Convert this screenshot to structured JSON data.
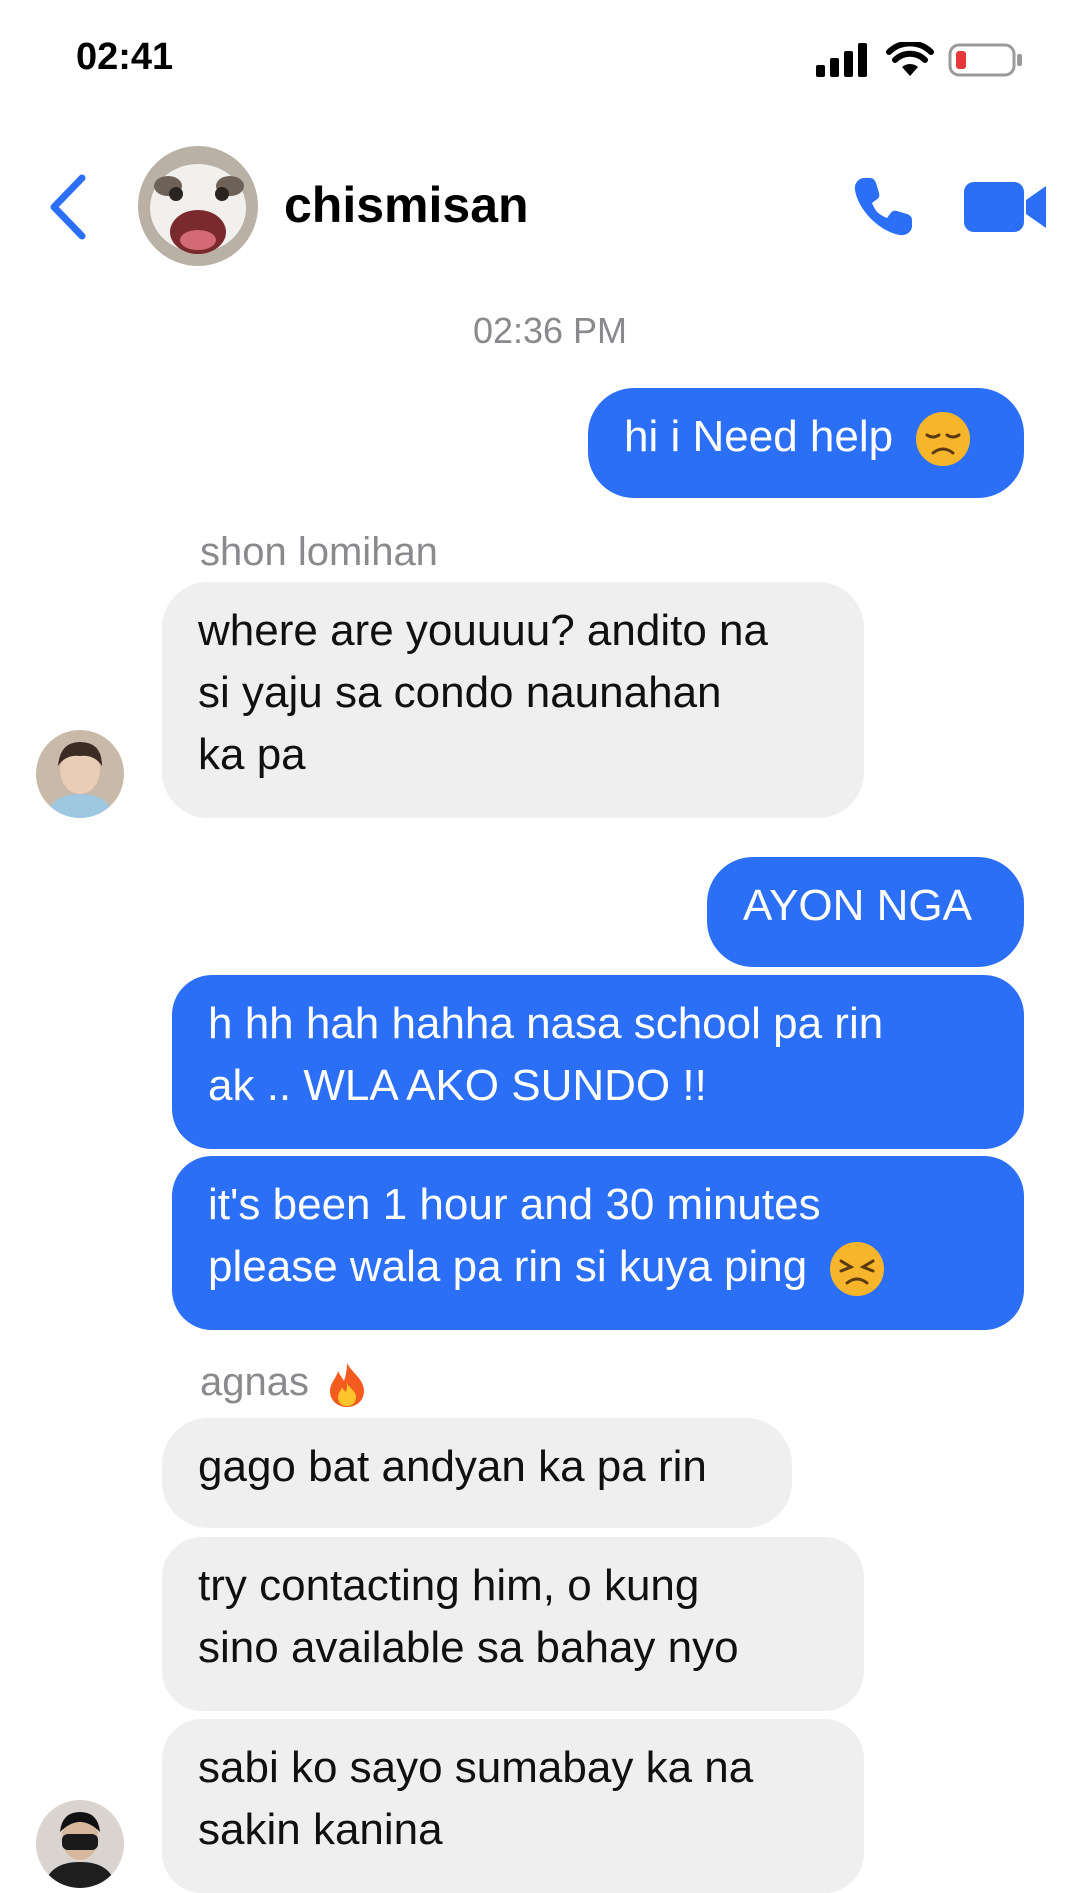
{
  "status_bar": {
    "time": "02:41"
  },
  "header": {
    "title": "chismisan"
  },
  "chat": {
    "timestamp": "02:36 PM",
    "messages": [
      {
        "text": "hi i Need help",
        "emoji": "disappointed-face"
      },
      {
        "sender": "shon lomihan"
      },
      {
        "line1": "where are youuuu? andito na",
        "line2": "si yaju sa condo naunahan",
        "line3": "ka pa"
      },
      {
        "text": "AYON NGA"
      },
      {
        "line1": "h hh hah hahha nasa school pa rin",
        "line2": "ak .. WLA AKO SUNDO !!"
      },
      {
        "line1": "it's been 1 hour and 30 minutes",
        "line2": "please wala pa rin si kuya ping",
        "emoji": "persevering-face"
      },
      {
        "sender": "agnas",
        "emoji": "fire"
      },
      {
        "text": "gago bat andyan ka pa rin"
      },
      {
        "line1": "try contacting him, o kung",
        "line2": "sino available sa bahay nyo"
      },
      {
        "line1": "sabi ko sayo sumabay ka na",
        "line2": "sakin kanina"
      }
    ]
  },
  "colors": {
    "accent": "#2b6ff6",
    "incoming_bubble": "#efefef",
    "meta_text": "#8a8a8e"
  }
}
